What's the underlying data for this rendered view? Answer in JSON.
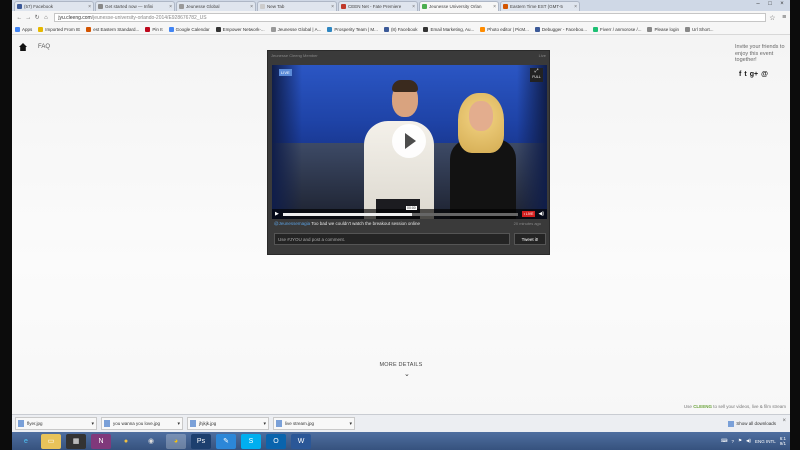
{
  "browser": {
    "tabs": [
      {
        "label": "(57) Facebook",
        "color": "#3b5998"
      },
      {
        "label": "Get started now — Infini",
        "color": "#888888"
      },
      {
        "label": "Jeunesse Global",
        "color": "#999999"
      },
      {
        "label": "New Tab",
        "color": "#cccccc"
      },
      {
        "label": "CEEN Net - Fate Premiere",
        "color": "#c0392b"
      },
      {
        "label": "Jeunesse University Orlan",
        "color": "#4caf50",
        "active": true
      },
      {
        "label": "Eastern Time EST (GMT-5",
        "color": "#d35400"
      }
    ],
    "window_controls": [
      "–",
      "□",
      "×"
    ],
    "url_host": "jyu.cleeng.com",
    "url_path": "/jeunesse-university-orlando-2014/E928676782_US",
    "bookmarks": [
      {
        "label": "Apps",
        "color": "#4285f4"
      },
      {
        "label": "Imported From IE",
        "color": "#e6b800"
      },
      {
        "label": "est Eastern Standard...",
        "color": "#d35400"
      },
      {
        "label": "Pin It",
        "color": "#bd081c"
      },
      {
        "label": "Google Calendar",
        "color": "#4285f4"
      },
      {
        "label": "Empower Network-...",
        "color": "#333333"
      },
      {
        "label": "Jeunesse Global | A...",
        "color": "#999999"
      },
      {
        "label": "Prosperity Team | M...",
        "color": "#2e86c1"
      },
      {
        "label": "(8) Facebook",
        "color": "#3b5998"
      },
      {
        "label": "Email Marketing, Au...",
        "color": "#333333"
      },
      {
        "label": "Photo editor | PicM...",
        "color": "#ff8c00"
      },
      {
        "label": "Debugger - Faceboo...",
        "color": "#3b5998"
      },
      {
        "label": "Fiverr / anmorose /...",
        "color": "#1dbf73"
      },
      {
        "label": "Please login",
        "color": "#888888"
      },
      {
        "label": "Url Short...",
        "color": "#888888"
      }
    ]
  },
  "page": {
    "nav": {
      "faq_label": "FAQ"
    },
    "invite_text": "Invite your friends to enjoy this event together!",
    "share_icons": [
      "f",
      "t",
      "g+",
      "@"
    ],
    "player": {
      "header_left": "Jeunesse Cleeng Member",
      "header_right": "Live",
      "badge": "LIVE",
      "fullscreen_label": "FULL",
      "progress": 0.55,
      "tooltip": "00:00",
      "live_button": "• LIVE",
      "comment_user": "@Jeunessemagia",
      "comment_text": "Too bad we couldn't watch the breakout session online",
      "comment_time": "20 minutes ago",
      "comment_placeholder": "Use #JYOU and post a comment.",
      "tweet_button": "Tweet it!"
    },
    "more_details": "MORE DETAILS",
    "powered_prefix": "Use",
    "powered_brand": "CLEENG",
    "powered_suffix": "to sell your videos, live & film stream"
  },
  "downloads": {
    "items": [
      "flyer.jpg",
      "you wanna you love.jpg",
      "jhjkjk.jpg",
      "live stream.jpg"
    ],
    "show_all": "Show all downloads"
  },
  "taskbar": {
    "icons": [
      "ie-icon",
      "explorer-icon",
      "winamp-icon",
      "onenote-icon",
      "media-icon",
      "camera-icon",
      "chrome-icon",
      "photoshop-icon",
      "pin-icon",
      "skype-icon",
      "outlook-icon",
      "word-icon"
    ],
    "tray_lang": "ENG INTL",
    "tray_time": "6:1",
    "tray_date": "9/1"
  }
}
